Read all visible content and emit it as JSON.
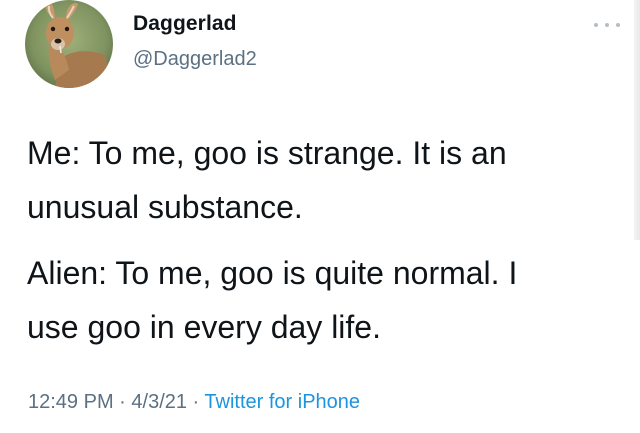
{
  "author": {
    "name": "Daggerlad",
    "handle": "@Daggerlad2",
    "avatar_icon": "water-deer-avatar"
  },
  "menu": {
    "icon": "more-options-icon"
  },
  "tweet": {
    "paragraph_1": "Me: To me, goo is strange. It is an\nunusual substance.",
    "paragraph_2": "Alien: To me, goo is quite normal. I\nuse goo in every day life."
  },
  "meta": {
    "time": "12:49 PM",
    "sep1": " · ",
    "date": "4/3/21",
    "sep2": " · ",
    "source": "Twitter for iPhone"
  },
  "colors": {
    "text": "#0f1419",
    "secondary": "#5b7083",
    "link": "#1b95e0"
  }
}
